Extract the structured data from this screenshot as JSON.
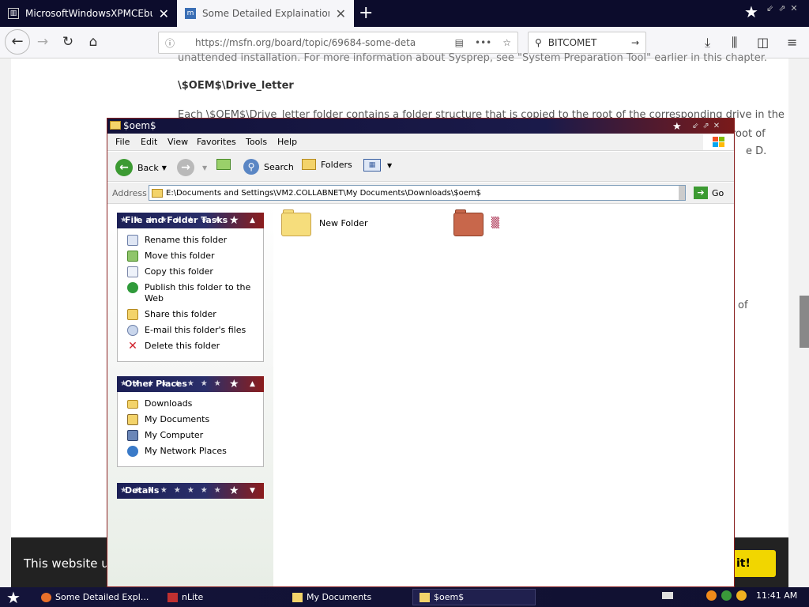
{
  "browser": {
    "tabs": [
      {
        "title": "MicrosoftWindowsXPMCEbuildcolle",
        "favicon": "books-icon",
        "active": false
      },
      {
        "title": "Some Detailed Explaination Of $OEM",
        "favicon": "msfn-icon",
        "active": true
      }
    ],
    "url": "https://msfn.org/board/topic/69684-some-deta",
    "search_value": "BITCOMET"
  },
  "article": {
    "line0": "unattended installation. For more information about Sysprep, see \"System Preparation Tool\" earlier in this chapter.",
    "heading": "\\$OEM$\\Drive_letter",
    "line1": "Each \\$OEM$\\Drive_letter folder contains a folder structure that is copied to the root of the corresponding drive in the",
    "frag1": "root of",
    "frag2": "e D.",
    "frag3": "of"
  },
  "cookie": {
    "text": "This website us",
    "button": "it!"
  },
  "explorer": {
    "title": "$oem$",
    "menu": [
      "File",
      "Edit",
      "View",
      "Favorites",
      "Tools",
      "Help"
    ],
    "toolbar": {
      "back": "Back",
      "search": "Search",
      "folders": "Folders"
    },
    "address_label": "Address",
    "address_value": "E:\\Documents and Settings\\VM2.COLLABNET\\My Documents\\Downloads\\$oem$",
    "go_label": "Go",
    "tasks_panel": {
      "title": "File and Folder Tasks",
      "items": [
        {
          "label": "Rename this folder",
          "icon": "rename-icon"
        },
        {
          "label": "Move this folder",
          "icon": "move-icon"
        },
        {
          "label": "Copy this folder",
          "icon": "copy-icon"
        },
        {
          "label": "Publish this folder to the Web",
          "icon": "publish-web-icon"
        },
        {
          "label": "Share this folder",
          "icon": "share-icon"
        },
        {
          "label": "E-mail this folder's files",
          "icon": "email-icon"
        },
        {
          "label": "Delete this folder",
          "icon": "delete-icon"
        }
      ]
    },
    "places_panel": {
      "title": "Other Places",
      "items": [
        {
          "label": "Downloads",
          "icon": "folder-icon"
        },
        {
          "label": "My Documents",
          "icon": "my-documents-icon"
        },
        {
          "label": "My Computer",
          "icon": "my-computer-icon"
        },
        {
          "label": "My Network Places",
          "icon": "network-places-icon"
        }
      ]
    },
    "details_panel": {
      "title": "Details"
    },
    "files": [
      {
        "name": "New Folder",
        "icon": "folder-icon"
      },
      {
        "name": "▒",
        "icon": "folder-icon"
      }
    ]
  },
  "taskbar": {
    "buttons": [
      "Some Detailed Expl...",
      "nLite",
      "My Documents",
      "$oem$"
    ],
    "clock": "11:41 AM"
  }
}
